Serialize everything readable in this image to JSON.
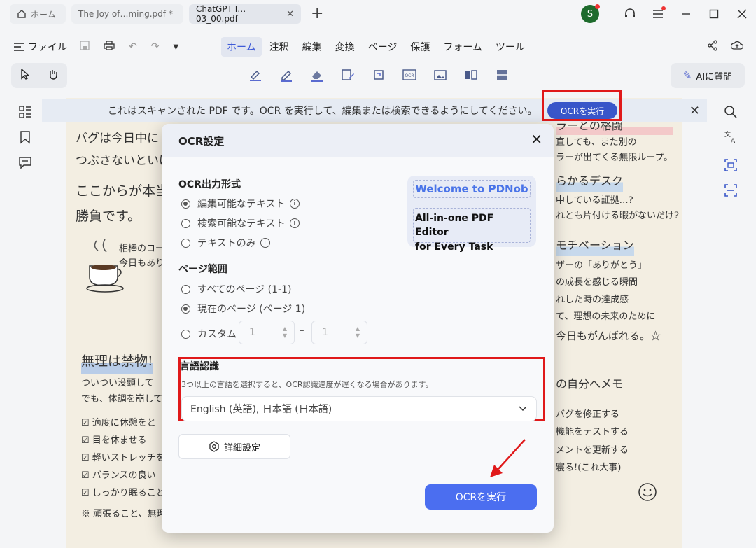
{
  "tabs": [
    {
      "label": "ホーム",
      "icon": "home-icon"
    },
    {
      "label": "The Joy of…ming.pdf *"
    },
    {
      "label": "ChatGPT I…03_00.pdf",
      "close": "✕"
    }
  ],
  "window": {
    "avatar_initial": "S"
  },
  "menu": {
    "file": "ファイル",
    "items": [
      "ホーム",
      "注釈",
      "編集",
      "変換",
      "ページ",
      "保護",
      "フォーム",
      "ツール"
    ]
  },
  "toolbar": {
    "ai_label": "AIに質問"
  },
  "notice": {
    "text": "これはスキャンされた PDF です。OCR を実行して、編集または検索できるようにしてください。",
    "button": "OCRを実行"
  },
  "document": {
    "lines_left": [
      "バグは今日中に",
      "つぶさないといけな",
      "ここからが本当",
      "勝負です。"
    ],
    "coffee_note": [
      "相棒のコーヒ",
      "今日もありが"
    ],
    "section_left": "無理は禁物!",
    "left_body": [
      "ついつい没頭して",
      "でも、体調を崩して"
    ],
    "checklist": [
      "適度に休憩をと",
      "目を休ませる",
      "軽いストレッチを",
      "バランスの良い",
      "しっかり眠ること"
    ],
    "left_footer": "※ 頑張ること、無理",
    "right_top": [
      "ラーとの格闘",
      "直しても、また別の",
      "ラーが出てくる無限ループ。"
    ],
    "right_desk": "らかるデスク",
    "right_desk_body": [
      "中している証拠…?",
      "れとも片付ける暇がないだけ?"
    ],
    "right_motivation": "モチベーション",
    "right_motivation_body": [
      "ザーの「ありがとう」",
      "の成長を感じる瞬間",
      "れした時の達成感",
      "て、理想の未来のために",
      "今日もがんばれる。☆"
    ],
    "right_memo": "の自分へメモ",
    "right_memo_body": [
      "バグを修正する",
      "機能をテストする",
      "メントを更新する",
      "寝る!(これ大事)"
    ]
  },
  "dialog": {
    "title": "OCR設定",
    "output_title": "OCR出力形式",
    "output_options": [
      {
        "label": "編集可能なテキスト",
        "selected": true
      },
      {
        "label": "検索可能なテキスト",
        "selected": false
      },
      {
        "label": "テキストのみ",
        "selected": false
      }
    ],
    "promo_line1": "Welcome to PDNob",
    "promo_line2": "All-in-one PDF Editor",
    "promo_line3": "for Every Task",
    "range_title": "ページ範囲",
    "range_options": [
      {
        "label": "すべてのページ (1-1)",
        "selected": false
      },
      {
        "label": "現在のページ (ページ 1)",
        "selected": true
      },
      {
        "label": "カスタム",
        "selected": false
      }
    ],
    "custom_from": "1",
    "custom_to": "1",
    "custom_dash": "–",
    "lang_title": "言語認識",
    "lang_note": "3つ以上の言語を選択すると、OCR認識速度が遅くなる場合があります。",
    "lang_value": "English (英語), 日本語 (日本語)",
    "advanced": "詳細設定",
    "run": "OCRを実行"
  },
  "colors": {
    "accent": "#4b6ef0",
    "highlight": "#e0191a",
    "notice_button": "#3956c9"
  }
}
